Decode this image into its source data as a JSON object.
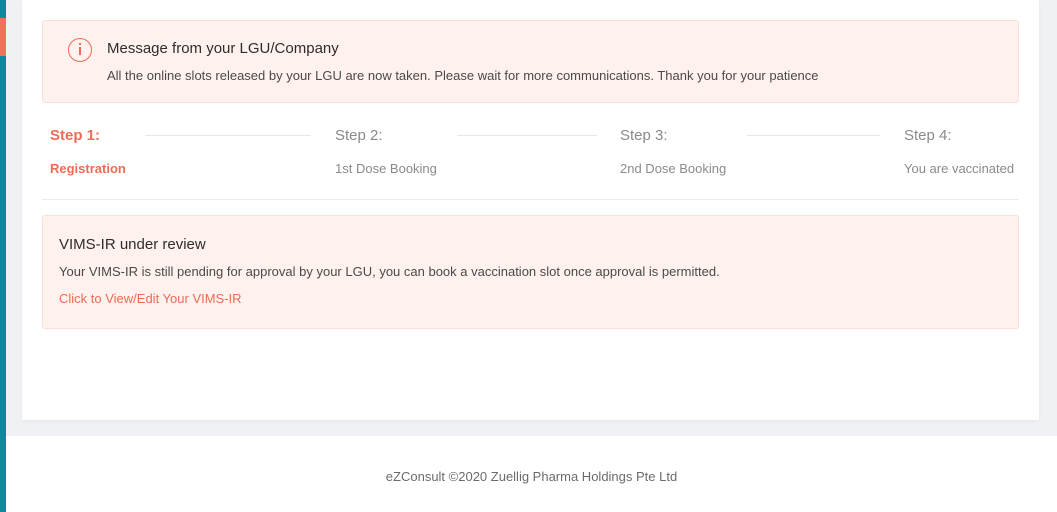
{
  "colors": {
    "accent": "#ef6b55",
    "alert_bg": "#fff1ed",
    "sidebar_teal": "#0b8a9c",
    "page_bg": "#f0f1f5"
  },
  "alert": {
    "icon": "info-circle-icon",
    "title": "Message from your LGU/Company",
    "text": "All the online slots released by your LGU are now taken. Please wait for more communications. Thank you for your patience"
  },
  "steps": [
    {
      "number": "Step 1:",
      "label": "Registration",
      "active": true
    },
    {
      "number": "Step 2:",
      "label": "1st Dose Booking",
      "active": false
    },
    {
      "number": "Step 3:",
      "label": "2nd Dose Booking",
      "active": false
    },
    {
      "number": "Step 4:",
      "label": "You are vaccinated",
      "active": false
    }
  ],
  "review": {
    "title": "VIMS-IR under review",
    "text": "Your VIMS-IR is still pending for approval by your LGU, you can book a vaccination slot once approval is permitted.",
    "link": "Click to View/Edit Your VIMS-IR"
  },
  "footer": {
    "text": "eZConsult ©2020 Zuellig Pharma Holdings Pte Ltd"
  }
}
